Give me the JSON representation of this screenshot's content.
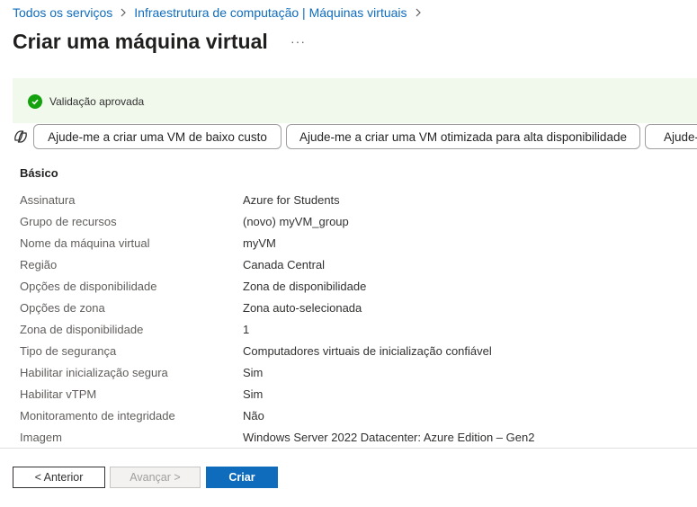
{
  "breadcrumb": {
    "items": [
      "Todos os serviços",
      "Infraestrutura de computação | Máquinas virtuais"
    ]
  },
  "page": {
    "title": "Criar uma máquina virtual",
    "more": "···"
  },
  "banner": {
    "text": "Validação aprovada",
    "status_color": "#13a10e",
    "background": "#f1f9ec"
  },
  "suggestions": [
    "Ajude-me a criar uma VM de baixo custo",
    "Ajude-me a criar uma VM otimizada para alta disponibilidade",
    "Ajude-"
  ],
  "section": {
    "title": "Básico",
    "rows": [
      {
        "label": "Assinatura",
        "value": "Azure for Students"
      },
      {
        "label": "Grupo de recursos",
        "value": "(novo) myVM_group"
      },
      {
        "label": "Nome da máquina virtual",
        "value": "myVM"
      },
      {
        "label": "Região",
        "value": "Canada Central"
      },
      {
        "label": "Opções de disponibilidade",
        "value": "Zona de disponibilidade"
      },
      {
        "label": "Opções de zona",
        "value": "Zona auto-selecionada"
      },
      {
        "label": "Zona de disponibilidade",
        "value": "1"
      },
      {
        "label": "Tipo de segurança",
        "value": "Computadores virtuais de inicialização confiável"
      },
      {
        "label": "Habilitar inicialização segura",
        "value": "Sim"
      },
      {
        "label": "Habilitar vTPM",
        "value": "Sim"
      },
      {
        "label": "Monitoramento de integridade",
        "value": "Não"
      },
      {
        "label": "Imagem",
        "value": "Windows Server 2022 Datacenter: Azure Edition – Gen2"
      }
    ]
  },
  "footer": {
    "prev": "< Anterior",
    "next": "Avançar >",
    "create": "Criar",
    "accent": "#0f6cbd"
  }
}
